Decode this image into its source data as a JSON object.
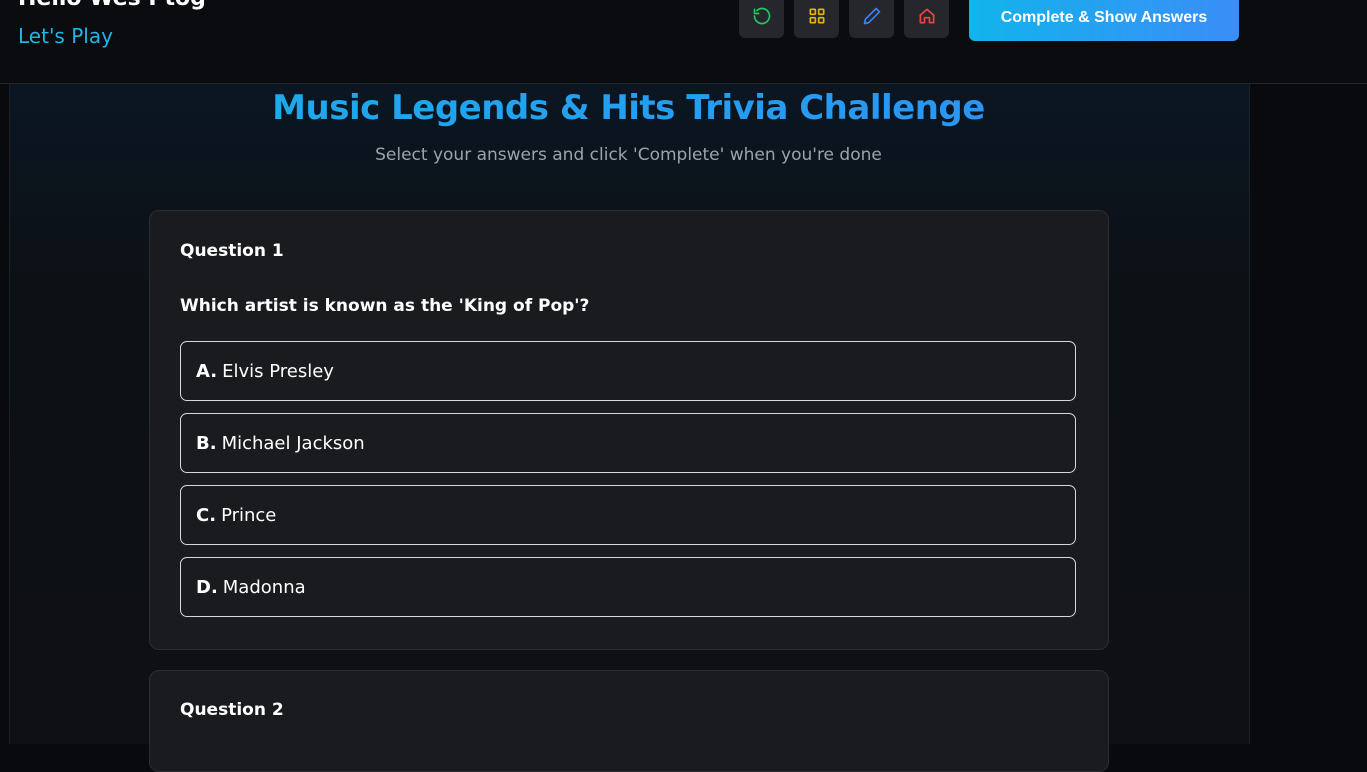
{
  "header": {
    "title": "Hello Wes Ptog",
    "subtitle": "Let's Play",
    "buttons": [
      {
        "name": "restart-icon",
        "color": "#22c55e"
      },
      {
        "name": "grid-icon",
        "color": "#eab308"
      },
      {
        "name": "pencil-icon",
        "color": "#3b82f6"
      },
      {
        "name": "home-icon",
        "color": "#ef4444"
      }
    ],
    "complete_label": "Complete & Show Answers"
  },
  "quiz": {
    "title": "Music Legends & Hits Trivia Challenge",
    "subtitle": "Select your answers and click 'Complete' when you're done",
    "questions": [
      {
        "number": "Question 1",
        "text": "Which artist is known as the 'King of Pop'?",
        "options": [
          {
            "letter": "A.",
            "text": "Elvis Presley"
          },
          {
            "letter": "B.",
            "text": "Michael Jackson"
          },
          {
            "letter": "C.",
            "text": "Prince"
          },
          {
            "letter": "D.",
            "text": "Madonna"
          }
        ]
      },
      {
        "number": "Question 2"
      }
    ]
  },
  "colors": {
    "accent": "#1fb5e8",
    "button_gradient_start": "#12b4ec",
    "button_gradient_end": "#3a8df7",
    "card_bg": "#1a1b1e"
  }
}
